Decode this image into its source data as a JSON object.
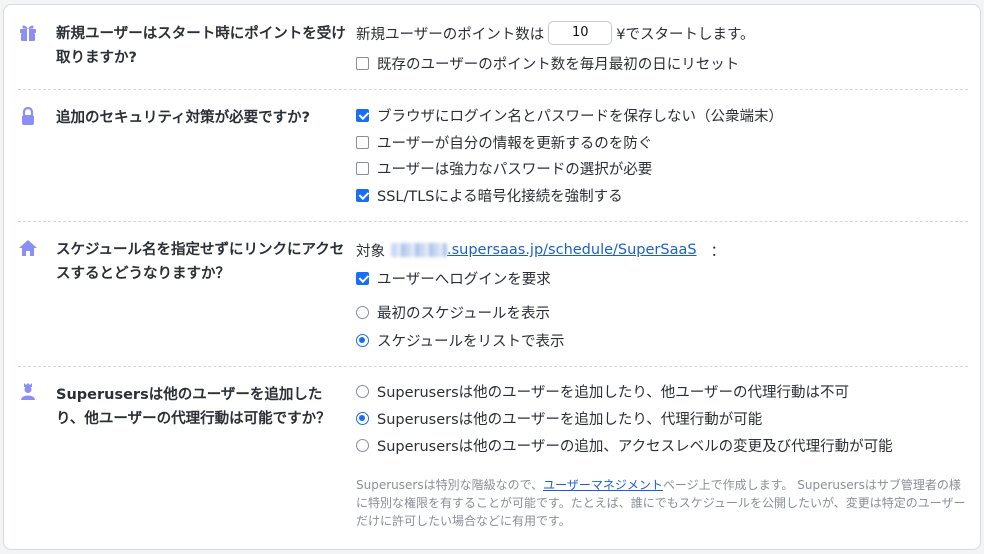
{
  "colors": {
    "icon": "#8b8ff5",
    "accent": "#1a6ef5",
    "link": "#1a5fd0",
    "help_text": "#8a8f98"
  },
  "sections": [
    {
      "icon": "gift-icon",
      "question": "新規ユーザーはスタート時にポイントを受け取りますか?",
      "start_points": {
        "prefix": "新規ユーザーのポイント数は",
        "value": "10",
        "suffix": "¥でスタートします。"
      },
      "reset_label": "既存のユーザーのポイント数を毎月最初の日にリセット"
    },
    {
      "icon": "lock-icon",
      "question": "追加のセキュリティ対策が必要ですか?",
      "options": [
        {
          "label": "ブラウザにログイン名とパスワードを保存しない（公衆端末）",
          "checked": true
        },
        {
          "label": "ユーザーが自分の情報を更新するのを防ぐ",
          "checked": false
        },
        {
          "label": "ユーザーは強力なパスワードの選択が必要",
          "checked": false
        },
        {
          "label": "SSL/TLSによる暗号化接続を強制する",
          "checked": true
        }
      ]
    },
    {
      "icon": "home-icon",
      "question": "スケジュール名を指定せずにリンクにアクセスするとどうなりますか？",
      "target_prefix": "対象",
      "target_link": ".supersaas.jp/schedule/SuperSaaS",
      "target_suffix": "：",
      "require_login_label": "ユーザーへログインを要求",
      "options": [
        {
          "label": "最初のスケジュールを表示",
          "selected": false
        },
        {
          "label": "スケジュールをリストで表示",
          "selected": true
        }
      ]
    },
    {
      "icon": "superuser-icon",
      "question": "Superusersは他のユーザーを追加したり、他ユーザーの代理行動は可能ですか？",
      "options": [
        {
          "label": "Superusersは他のユーザーを追加したり、他ユーザーの代理行動は不可",
          "selected": false
        },
        {
          "label": "Superusersは他のユーザーを追加したり、代理行動が可能",
          "selected": true
        },
        {
          "label": "Superusersは他のユーザーの追加、アクセスレベルの変更及び代理行動が可能",
          "selected": false
        }
      ],
      "help": {
        "before": "Superusersは特別な階級なので、",
        "link": "ユーザーマネジメント",
        "after": "ページ上で作成します。 Superusersはサブ管理者の様に特別な権限を有することが可能です。たとえば、誰にでもスケジュールを公開したいが、変更は特定のユーザーだけに許可したい場合などに有用です。"
      }
    }
  ]
}
